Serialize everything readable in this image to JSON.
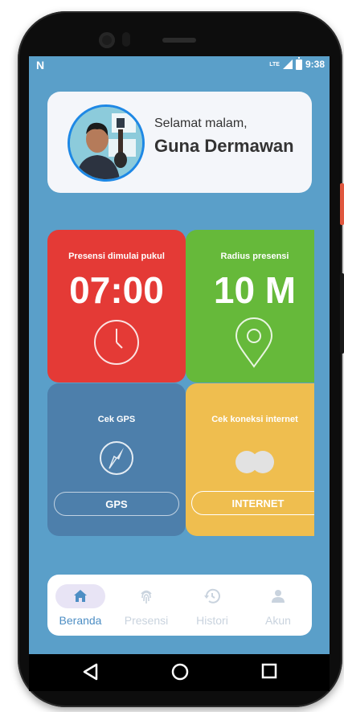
{
  "status_bar": {
    "carrier_icon": "n-notification-icon",
    "network": "LTE",
    "time": "9:38"
  },
  "greeting": {
    "salutation": "Selamat malam,",
    "name": "Guna Dermawan",
    "avatar": "profile-photo"
  },
  "tiles": {
    "start_time": {
      "title": "Presensi dimulai pukul",
      "value": "07:00",
      "icon": "clock-icon",
      "color": "#e43a36"
    },
    "radius": {
      "title": "Radius presensi",
      "value": "10 M",
      "icon": "location-pin-icon",
      "color": "#66b93a"
    },
    "gps": {
      "title": "Cek GPS",
      "button": "GPS",
      "icon": "compass-icon",
      "color": "#4d7fab"
    },
    "internet": {
      "title": "Cek koneksi internet",
      "button": "INTERNET",
      "icon": "toggle-dots-icon",
      "color": "#efbe4f"
    }
  },
  "bottom_nav": {
    "items": [
      {
        "label": "Beranda",
        "icon": "home-icon",
        "active": true
      },
      {
        "label": "Presensi",
        "icon": "fingerprint-icon",
        "active": false
      },
      {
        "label": "Histori",
        "icon": "history-icon",
        "active": false
      },
      {
        "label": "Akun",
        "icon": "person-icon",
        "active": false
      }
    ],
    "active_color": "#4d8ec4",
    "inactive_color": "#c9d3de"
  },
  "system_nav": {
    "back": "back-icon",
    "home": "home-circle-icon",
    "recents": "recents-icon"
  }
}
